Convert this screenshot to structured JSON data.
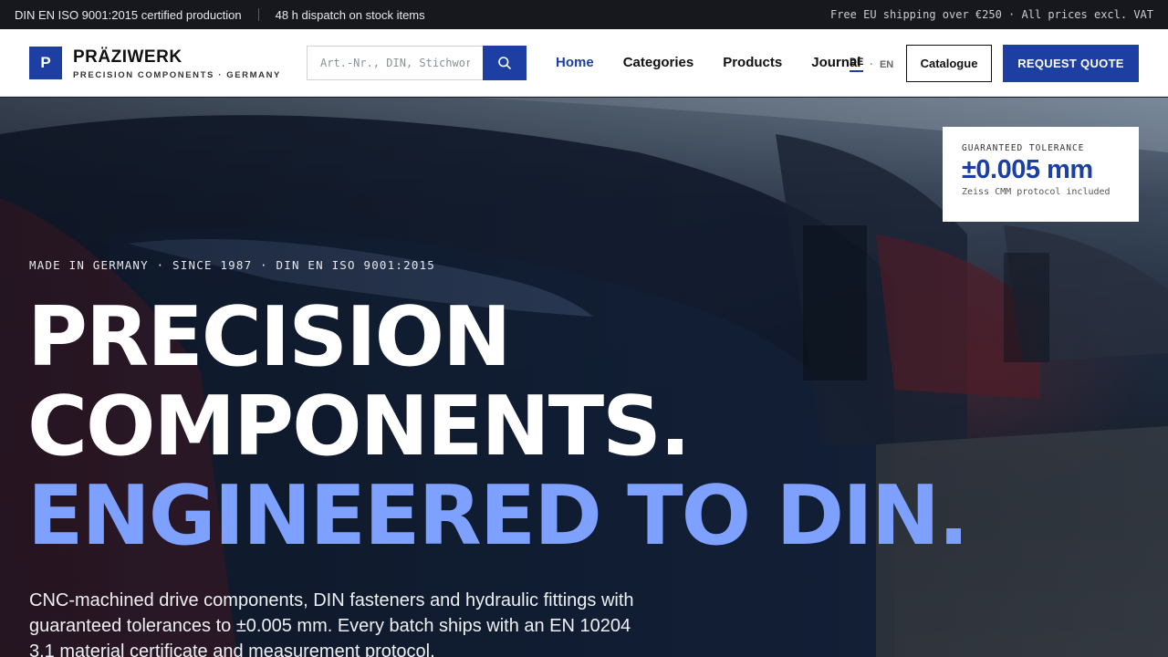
{
  "topbar": {
    "certified": "DIN EN ISO 9001:2015 certified production",
    "dispatch": "48 h dispatch on stock items",
    "shipping": "Free EU shipping over €250 · All prices excl. VAT"
  },
  "header": {
    "logo_letter": "P",
    "brand_name": "PRÄZIWERK",
    "brand_sub": "PRECISION COMPONENTS · GERMANY",
    "search_placeholder": "Art.-Nr., DIN, Stichwort",
    "nav": [
      "Home",
      "Categories",
      "Products",
      "Journal"
    ],
    "lang_de": "DE",
    "lang_sep": "·",
    "lang_en": "EN",
    "catalogue_label": "Catalogue",
    "quote_label": "REQUEST QUOTE"
  },
  "hero": {
    "eyebrow": "MADE IN GERMANY · SINCE 1987 · DIN EN ISO 9001:2015",
    "headline_1": "PRECISION",
    "headline_2": "COMPONENTS.",
    "headline_3": "ENGINEERED TO DIN.",
    "lead": "CNC-machined drive components, DIN fasteners and hydraulic fittings with guaranteed tolerances to ±0.005 mm. Every batch ships with an EN 10204 3.1 material certificate and measurement protocol.",
    "tolerance_label": "GUARANTEED TOLERANCE",
    "tolerance_value": "±0.005 mm",
    "tolerance_note": "Zeiss CMM protocol included"
  },
  "colors": {
    "brand_blue": "#1d3fa3",
    "accent_light_blue": "#7ea1ff",
    "topbar_bg": "#16181d"
  }
}
